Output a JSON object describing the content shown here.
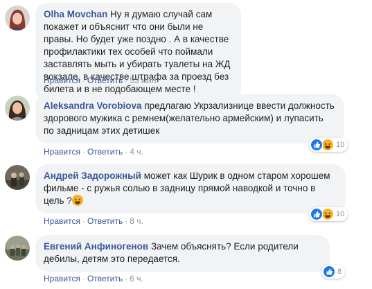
{
  "comments": [
    {
      "author": "Olha Movchan",
      "text": "Ну я думаю случай сам покажет и объяснит что они были не правы. Но будет уже поздно . А в качестве профилактики тех особей что поймали заставлять мыть и убирать туалеты на ЖД вокзале, в качестве штрафа за проезд без билета и в не подобающем месте !",
      "like_label": "Нравится",
      "reply_label": "Ответить",
      "time": "53 мин."
    },
    {
      "author": "Aleksandra Vorobiova",
      "text": "предлагаю Укрзализнице ввести должность здорового мужика с ремнем(желательно армейским) и лупасить по задницам этих детишек",
      "like_label": "Нравится",
      "reply_label": "Ответить",
      "time": "4 ч.",
      "reaction_count": "10"
    },
    {
      "author": "Андрей Задорожный",
      "text": "может как Шурик в одном старом хорошем фильме - с ружья солью в задницу прямой наводкой и точно в цель ?",
      "like_label": "Нравится",
      "reply_label": "Ответить",
      "time": "8 ч.",
      "reaction_count": "10"
    },
    {
      "author": "Евгений Анфиногенов",
      "text": "Зачем объяснять? Если родители дебилы, детям это передается.",
      "like_label": "Нравится",
      "reply_label": "Ответить",
      "time": "6 ч.",
      "reaction_count": "8"
    }
  ],
  "separator": "·",
  "colors": {
    "link": "#385898",
    "bubble": "#f2f3f5",
    "meta": "#90949c",
    "like": "#1877f2",
    "haha": "#f7b125"
  },
  "icons": {
    "like": "like-reaction-icon",
    "haha": "haha-reaction-icon",
    "inline": "laughing-emoji-icon"
  }
}
